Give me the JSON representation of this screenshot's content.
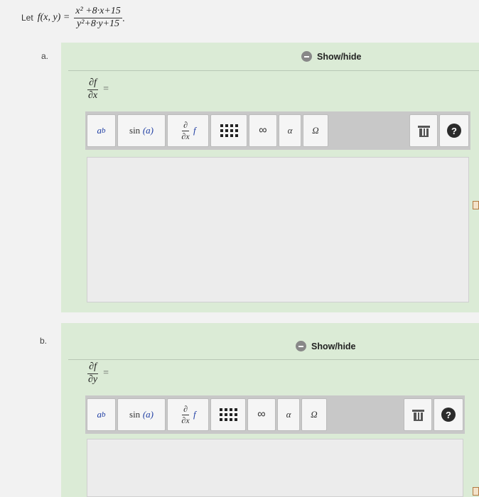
{
  "problem": {
    "let": "Let",
    "function_lhs": "f(x, y) =",
    "numerator": "x² +8·x+15",
    "denominator": "y²+8·y+15",
    "end": "."
  },
  "parts": [
    {
      "label": "a.",
      "show_hide": "Show/hide",
      "deriv_num": "∂f",
      "deriv_den": "∂x",
      "equals": "="
    },
    {
      "label": "b.",
      "show_hide": "Show/hide",
      "deriv_num": "∂f",
      "deriv_den": "∂y",
      "equals": "="
    }
  ],
  "toolbar": {
    "power_base": "a",
    "power_exp": "b",
    "sin_fn": "sin",
    "sin_arg": "(a)",
    "partial_num": "∂",
    "partial_den": "∂x",
    "partial_f": "f",
    "infinity": "∞",
    "alpha": "α",
    "omega": "Ω",
    "help": "?"
  }
}
